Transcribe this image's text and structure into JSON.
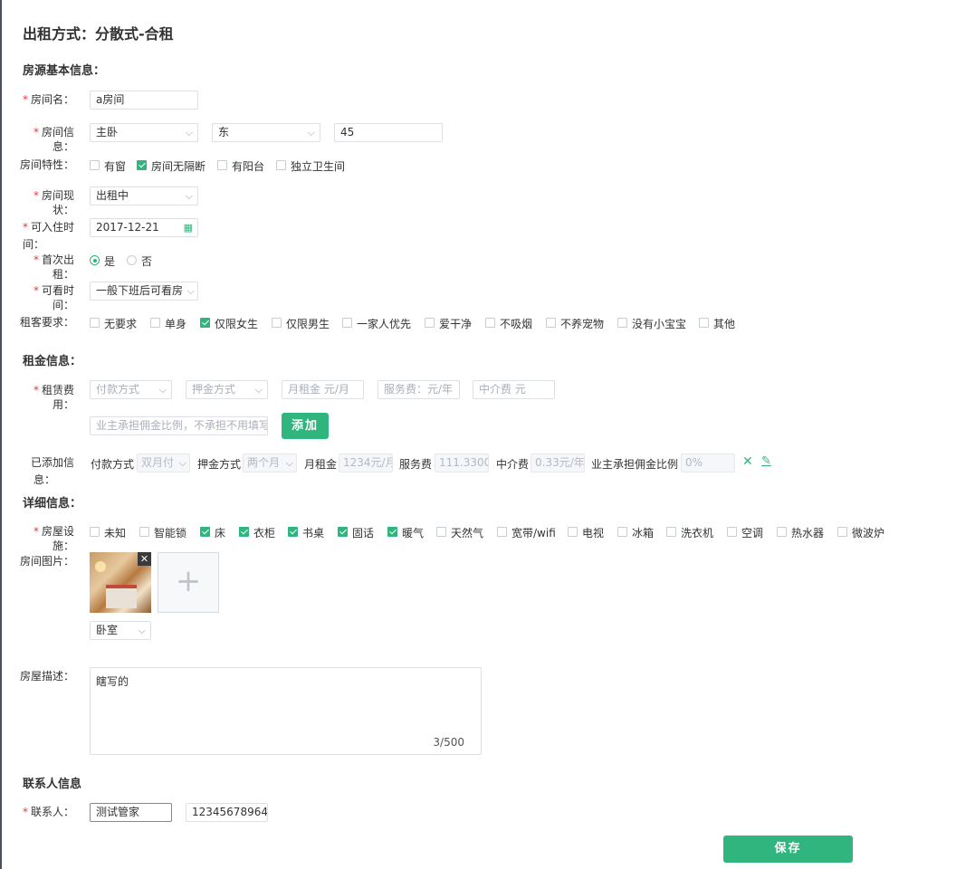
{
  "page_title": "出租方式：分散式-合租",
  "sections": {
    "basic": "房源基本信息：",
    "rent": "租金信息：",
    "detail": "详细信息：",
    "contact": "联系人信息"
  },
  "labels": {
    "room_name": "房间名：",
    "room_info": "房间信息：",
    "room_features": "房间特性：",
    "room_status": "房间现状：",
    "move_in_line1": "可入住时",
    "move_in_line2": "间：",
    "first_rent": "首次出租：",
    "viewing_time": "可看时间：",
    "tenant_req": "租客要求：",
    "rent_fee": "租赁费用：",
    "added_line1": "已添加信",
    "added_line2": "息：",
    "facilities": "房屋设施：",
    "room_images": "房间图片：",
    "description": "房屋描述：",
    "contact": "联系人："
  },
  "fields": {
    "room_name": "a房间",
    "room_type": "主卧",
    "orientation": "东",
    "area": "45",
    "room_status": "出租中",
    "move_in_date": "2017-12-21",
    "viewing_time": "一般下班后可看房",
    "image_category": "卧室",
    "description": "瞎写的",
    "description_counter": "3/500",
    "contact_name": "测试管家",
    "contact_phone": "12345678964"
  },
  "room_features": [
    {
      "label": "有窗",
      "checked": false
    },
    {
      "label": "房间无隔断",
      "checked": true
    },
    {
      "label": "有阳台",
      "checked": false
    },
    {
      "label": "独立卫生间",
      "checked": false
    }
  ],
  "first_rent_options": [
    {
      "label": "是",
      "selected": true
    },
    {
      "label": "否",
      "selected": false
    }
  ],
  "tenant_requirements": [
    {
      "label": "无要求",
      "checked": false
    },
    {
      "label": "单身",
      "checked": false
    },
    {
      "label": "仅限女生",
      "checked": true
    },
    {
      "label": "仅限男生",
      "checked": false
    },
    {
      "label": "一家人优先",
      "checked": false
    },
    {
      "label": "爱干净",
      "checked": false
    },
    {
      "label": "不吸烟",
      "checked": false
    },
    {
      "label": "不养宠物",
      "checked": false
    },
    {
      "label": "没有小宝宝",
      "checked": false
    },
    {
      "label": "其他",
      "checked": false
    }
  ],
  "rent_inputs": {
    "payment_method_placeholder": "付款方式",
    "deposit_method_placeholder": "押金方式",
    "monthly_rent_placeholder": "月租金 元/月",
    "service_fee_placeholder": "服务费：元/年",
    "agency_fee_placeholder": "中介费 元",
    "owner_commission_placeholder": "业主承担佣金比例，不承担不用填写",
    "add_button": "添加"
  },
  "added_info": {
    "payment_label": "付款方式",
    "payment_value": "双月付",
    "deposit_label": "押金方式",
    "deposit_value": "两个月",
    "rent_label": "月租金",
    "rent_value": "1234元/月",
    "service_label": "服务费",
    "service_value": "111.3300",
    "agency_label": "中介费",
    "agency_value": "0.33元/年",
    "commission_label": "业主承担佣金比例",
    "commission_value": "0%"
  },
  "facilities": [
    {
      "label": "未知",
      "checked": false
    },
    {
      "label": "智能锁",
      "checked": false
    },
    {
      "label": "床",
      "checked": true
    },
    {
      "label": "衣柜",
      "checked": true
    },
    {
      "label": "书桌",
      "checked": true
    },
    {
      "label": "固话",
      "checked": true
    },
    {
      "label": "暖气",
      "checked": true
    },
    {
      "label": "天然气",
      "checked": false
    },
    {
      "label": "宽带/wifi",
      "checked": false
    },
    {
      "label": "电视",
      "checked": false
    },
    {
      "label": "冰箱",
      "checked": false
    },
    {
      "label": "洗衣机",
      "checked": false
    },
    {
      "label": "空调",
      "checked": false
    },
    {
      "label": "热水器",
      "checked": false
    },
    {
      "label": "微波炉",
      "checked": false
    }
  ],
  "save_button": "保存",
  "colors": {
    "accent": "#2fb57d",
    "required": "#e23b3b"
  }
}
